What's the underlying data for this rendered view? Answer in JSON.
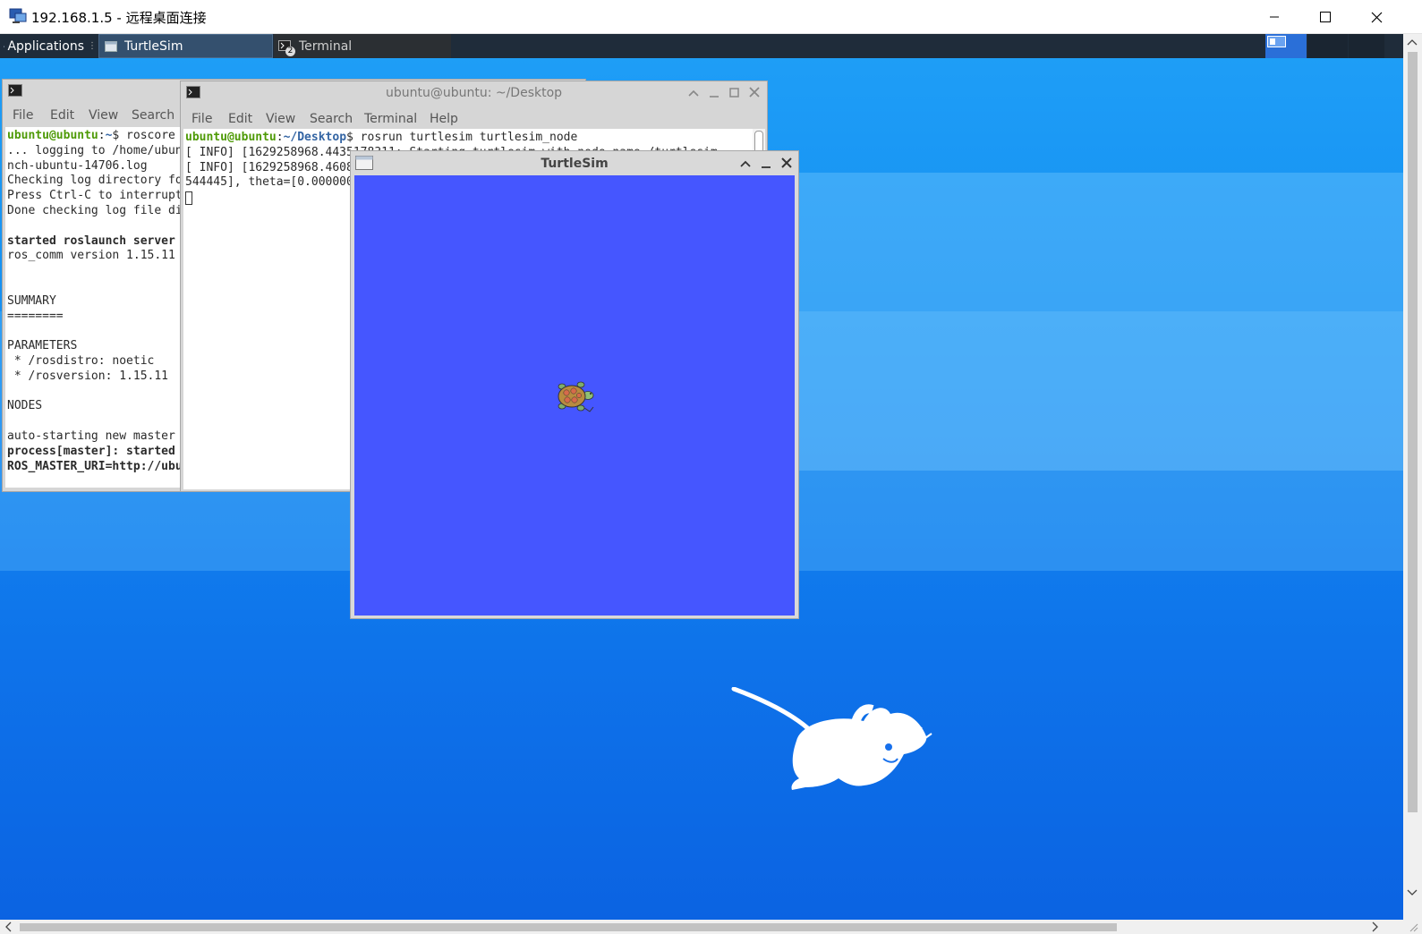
{
  "rdp": {
    "title": "192.168.1.5 - 远程桌面连接"
  },
  "panel": {
    "applications_label": "Applications",
    "tasks": [
      {
        "label": "TurtleSim"
      },
      {
        "label": "Terminal",
        "badge": "2"
      }
    ]
  },
  "term1": {
    "menu": [
      "File",
      "Edit",
      "View",
      "Search"
    ],
    "lines": [
      {
        "user": "ubuntu@ubuntu",
        "path": "~",
        "cmd": "$ roscore"
      },
      {
        "text": "... logging to /home/ubun"
      },
      {
        "text": "nch-ubuntu-14706.log"
      },
      {
        "text": "Checking log directory fo"
      },
      {
        "text": "Press Ctrl-C to interrupt"
      },
      {
        "text": "Done checking log file di"
      },
      {
        "text": ""
      },
      {
        "text": "started roslaunch server",
        "bold": true
      },
      {
        "text": "ros_comm version 1.15.11"
      },
      {
        "text": ""
      },
      {
        "text": ""
      },
      {
        "text": "SUMMARY"
      },
      {
        "text": "========"
      },
      {
        "text": ""
      },
      {
        "text": "PARAMETERS"
      },
      {
        "text": " * /rosdistro: noetic"
      },
      {
        "text": " * /rosversion: 1.15.11"
      },
      {
        "text": ""
      },
      {
        "text": "NODES"
      },
      {
        "text": ""
      },
      {
        "text": "auto-starting new master"
      },
      {
        "text": "process[master]: started",
        "bold": true
      },
      {
        "text": "ROS_MASTER_URI=http://ubu",
        "bold": true
      }
    ]
  },
  "term2": {
    "title": "ubuntu@ubuntu: ~/Desktop",
    "menu": [
      "File",
      "Edit",
      "View",
      "Search",
      "Terminal",
      "Help"
    ],
    "lines": [
      {
        "user": "ubuntu@ubuntu",
        "path": "~/Desktop",
        "cmd": "$ rosrun turtlesim turtlesim_node"
      },
      {
        "text": "[ INFO] [1629258968.4435178311: Starting turtlesim with node name /turtlesim"
      },
      {
        "text": "[ INFO] [1629258968.4608"
      },
      {
        "text": "544445], theta=[0.000000"
      }
    ]
  },
  "turtlesim": {
    "title": "TurtleSim",
    "bg_color": "#4556ff"
  }
}
